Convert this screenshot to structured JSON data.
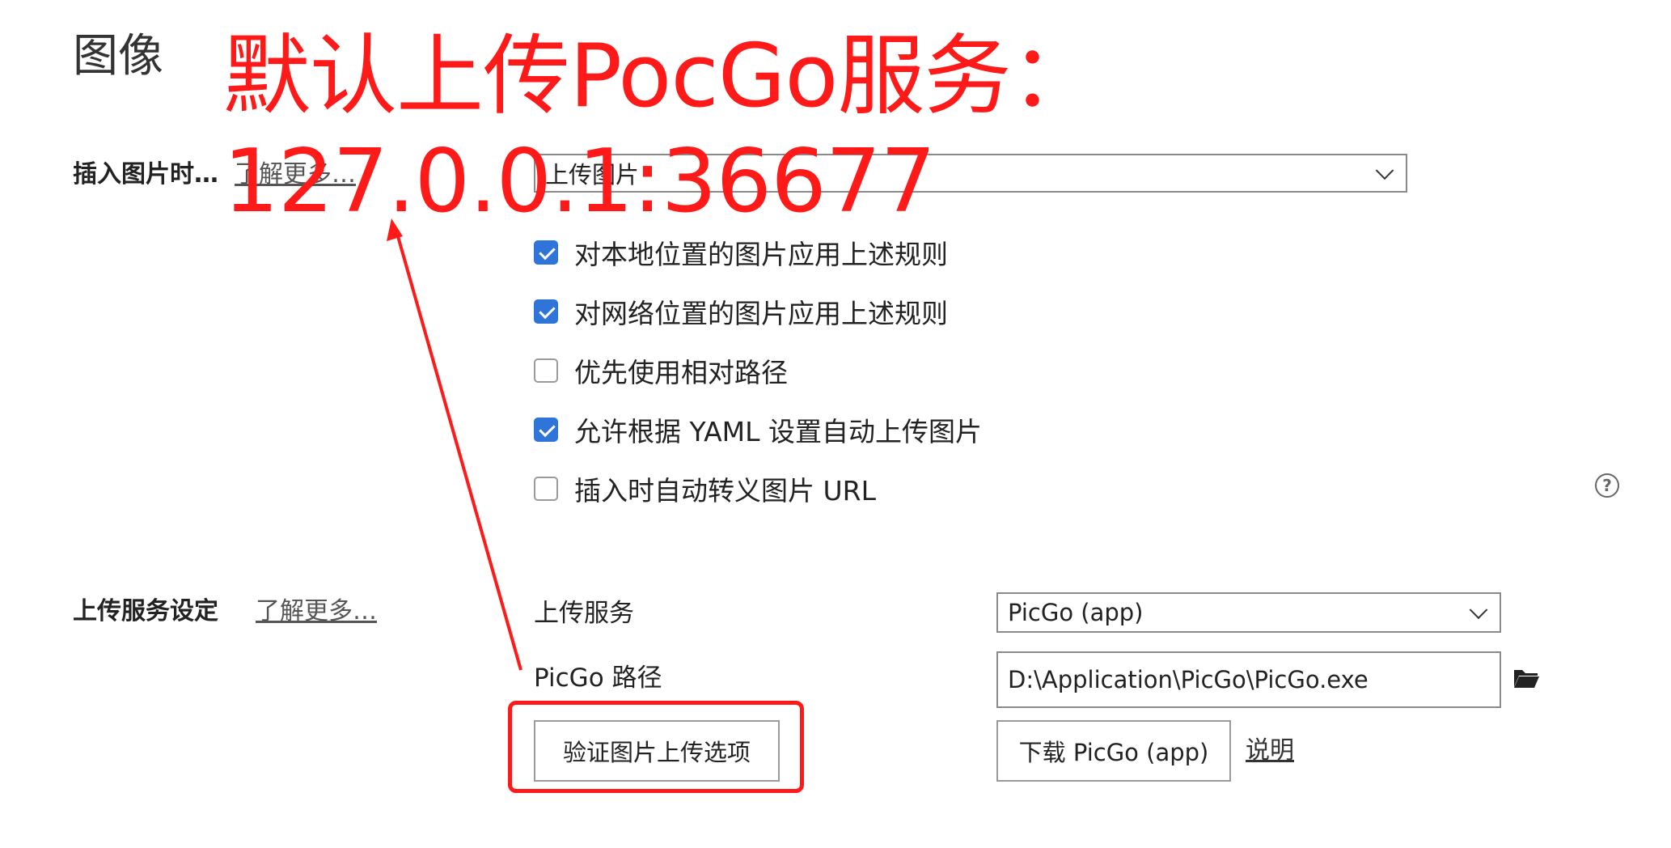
{
  "page": {
    "title": "图像",
    "annotation": "默认上传PocGo服务：127.0.0.1:36677"
  },
  "insert_section": {
    "label": "插入图片时…",
    "learn_more": "了解更多…",
    "select_value": "上传图片",
    "options": [
      {
        "label": "对本地位置的图片应用上述规则",
        "checked": true
      },
      {
        "label": "对网络位置的图片应用上述规则",
        "checked": true
      },
      {
        "label": "优先使用相对路径",
        "checked": false
      },
      {
        "label": "允许根据 YAML 设置自动上传图片",
        "checked": true
      },
      {
        "label": "插入时自动转义图片 URL",
        "checked": false
      }
    ]
  },
  "upload_section": {
    "label": "上传服务设定",
    "learn_more": "了解更多…",
    "service_label": "上传服务",
    "service_value": "PicGo (app)",
    "path_label": "PicGo 路径",
    "path_value": "D:\\Application\\PicGo\\PicGo.exe",
    "verify_button": "验证图片上传选项",
    "download_button": "下载 PicGo (app)",
    "help_link": "说明"
  },
  "colors": {
    "annotation": "#ff1a1a",
    "checkbox_checked": "#2f74d9"
  }
}
